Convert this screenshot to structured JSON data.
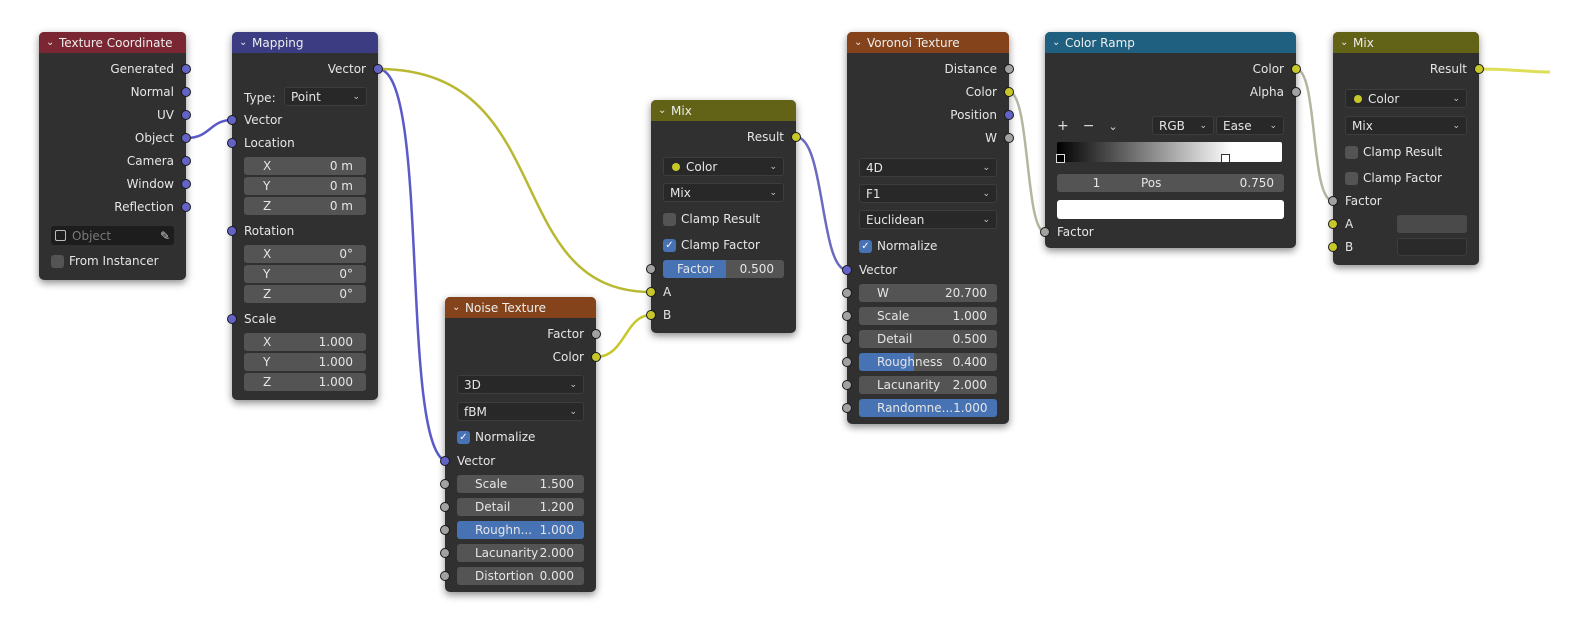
{
  "nodes": {
    "texcoord": {
      "title": "Texture Coordinate",
      "outputs": [
        "Generated",
        "Normal",
        "UV",
        "Object",
        "Camera",
        "Window",
        "Reflection"
      ],
      "object_placeholder": "Object",
      "from_instancer": "From Instancer"
    },
    "mapping": {
      "title": "Mapping",
      "output": "Vector",
      "type_label": "Type:",
      "type_value": "Point",
      "vector_label": "Vector",
      "location_label": "Location",
      "location": [
        {
          "axis": "X",
          "value": "0 m"
        },
        {
          "axis": "Y",
          "value": "0 m"
        },
        {
          "axis": "Z",
          "value": "0 m"
        }
      ],
      "rotation_label": "Rotation",
      "rotation": [
        {
          "axis": "X",
          "value": "0°"
        },
        {
          "axis": "Y",
          "value": "0°"
        },
        {
          "axis": "Z",
          "value": "0°"
        }
      ],
      "scale_label": "Scale",
      "scale": [
        {
          "axis": "X",
          "value": "1.000"
        },
        {
          "axis": "Y",
          "value": "1.000"
        },
        {
          "axis": "Z",
          "value": "1.000"
        }
      ]
    },
    "noise": {
      "title": "Noise Texture",
      "outputs": [
        "Factor",
        "Color"
      ],
      "dimensions": "3D",
      "type": "fBM",
      "normalize": "Normalize",
      "vector_label": "Vector",
      "fields": [
        {
          "label": "Scale",
          "value": "1.500",
          "highlight": false
        },
        {
          "label": "Detail",
          "value": "1.200",
          "highlight": false
        },
        {
          "label": "Roughn...",
          "value": "1.000",
          "highlight": true
        },
        {
          "label": "Lacunarity",
          "value": "2.000",
          "highlight": false
        },
        {
          "label": "Distortion",
          "value": "0.000",
          "highlight": false
        }
      ]
    },
    "mix1": {
      "title": "Mix",
      "output": "Result",
      "data_type": "Color",
      "blend": "Mix",
      "clamp_result": "Clamp Result",
      "clamp_factor": "Clamp Factor",
      "factor_label": "Factor",
      "factor_value": "0.500",
      "input_a": "A",
      "input_b": "B"
    },
    "voronoi": {
      "title": "Voronoi Texture",
      "outputs": [
        "Distance",
        "Color",
        "Position",
        "W"
      ],
      "dimensions": "4D",
      "feature": "F1",
      "metric": "Euclidean",
      "normalize": "Normalize",
      "vector_label": "Vector",
      "fields": [
        {
          "label": "W",
          "value": "20.700"
        },
        {
          "label": "Scale",
          "value": "1.000"
        },
        {
          "label": "Detail",
          "value": "0.500"
        },
        {
          "label": "Roughness",
          "value": "0.400"
        },
        {
          "label": "Lacunarity",
          "value": "2.000"
        },
        {
          "label": "Randomne...",
          "value": "1.000"
        }
      ]
    },
    "ramp": {
      "title": "Color Ramp",
      "outputs": [
        "Color",
        "Alpha"
      ],
      "add": "+",
      "remove": "−",
      "menu": "⌄",
      "color_mode": "RGB",
      "interpolation": "Ease",
      "stop_index": "1",
      "pos_label": "Pos",
      "pos_value": "0.750",
      "factor_label": "Factor"
    },
    "mix2": {
      "title": "Mix",
      "output": "Result",
      "data_type": "Color",
      "blend": "Mix",
      "clamp_result": "Clamp Result",
      "clamp_factor": "Clamp Factor",
      "factor_label": "Factor",
      "input_a": "A",
      "input_b": "B"
    }
  },
  "colors": {
    "vector_socket": "#6363c7",
    "color_socket": "#c7c729",
    "float_socket": "#a1a1a1",
    "selected_field": "#4772b3"
  }
}
